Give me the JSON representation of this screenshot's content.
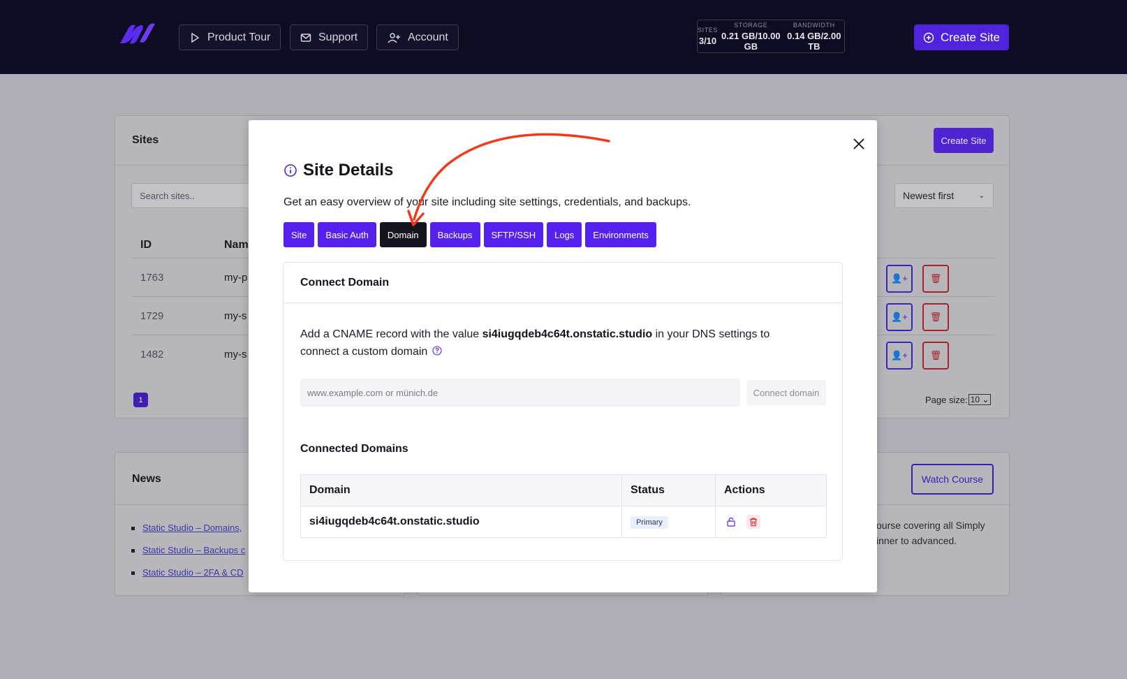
{
  "header": {
    "nav": [
      {
        "label": "Product Tour",
        "icon": "play-icon"
      },
      {
        "label": "Support",
        "icon": "mail-icon"
      },
      {
        "label": "Account",
        "icon": "user-plus-icon"
      }
    ],
    "stats": [
      {
        "key": "SITES",
        "value": "3/10"
      },
      {
        "key": "STORAGE",
        "value": "0.21 GB/10.00 GB"
      },
      {
        "key": "BANDWIDTH",
        "value": "0.14 GB/2.00 TB"
      }
    ],
    "create_site": "Create Site"
  },
  "sites_panel": {
    "title": "Sites",
    "create_site": "Create Site",
    "search_placeholder": "Search sites..",
    "sort": "Newest first",
    "col_id": "ID",
    "col_name": "Nam",
    "rows": [
      {
        "id": "1763",
        "name": "my-p"
      },
      {
        "id": "1729",
        "name": "my-s"
      },
      {
        "id": "1482",
        "name": "my-s"
      }
    ],
    "page": "1",
    "page_size_label": "Page size:",
    "page_size": "10"
  },
  "news_panel": {
    "title": "News",
    "links": [
      "Static Studio – Domains,",
      "Static Studio – Backups c",
      "Static Studio – 2FA & CD"
    ],
    "watch_course": "Watch Course",
    "course_text_1": "ourse covering all Simply",
    "course_text_2": "inner to advanced."
  },
  "modal": {
    "title": "Site Details",
    "subtitle": "Get an easy overview of your site including site settings, credentials, and backups.",
    "tabs": [
      "Site",
      "Basic Auth",
      "Domain",
      "Backups",
      "SFTP/SSH",
      "Logs",
      "Environments"
    ],
    "active_tab": "Domain",
    "connect": {
      "title": "Connect Domain",
      "text_before": "Add a CNAME record with the value ",
      "cname_value": "si4iugqdeb4c64t.onstatic.studio",
      "text_after": " in your DNS settings to connect a custom domain",
      "input_placeholder": "www.example.com or münich.de",
      "button": "Connect domain"
    },
    "connected": {
      "title": "Connected Domains",
      "headers": [
        "Domain",
        "Status",
        "Actions"
      ],
      "rows": [
        {
          "domain": "si4iugqdeb4c64t.onstatic.studio",
          "status": "Primary"
        }
      ]
    }
  },
  "colors": {
    "accent": "#5521ee",
    "header_bg": "#0e0c22",
    "danger": "#d2323c",
    "annotation_arrow": "#ee3a1e"
  }
}
